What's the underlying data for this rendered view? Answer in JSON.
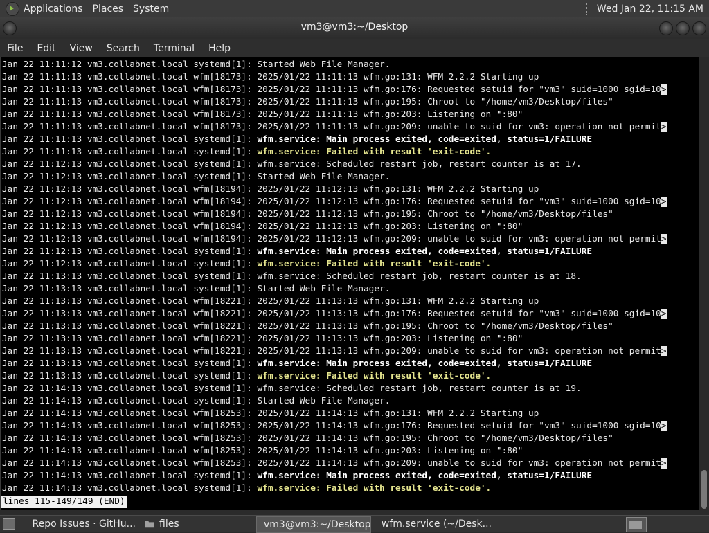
{
  "top_panel": {
    "menus": [
      "Applications",
      "Places",
      "System"
    ],
    "clock": "Wed Jan 22, 11:15 AM"
  },
  "window": {
    "title": "vm3@vm3:~/Desktop"
  },
  "menubar": [
    "File",
    "Edit",
    "View",
    "Search",
    "Terminal",
    "Help"
  ],
  "terminal": {
    "lines": [
      {
        "p": "Jan 22 11:11:12 vm3.collabnet.local systemd[1]: ",
        "m": "Started Web File Manager.",
        "s": "n",
        "t": false
      },
      {
        "p": "Jan 22 11:11:13 vm3.collabnet.local wfm[18173]: ",
        "m": "2025/01/22 11:11:13 wfm.go:131: WFM 2.2.2 Starting up",
        "s": "n",
        "t": false
      },
      {
        "p": "Jan 22 11:11:13 vm3.collabnet.local wfm[18173]: ",
        "m": "2025/01/22 11:11:13 wfm.go:176: Requested setuid for \"vm3\" suid=1000 sgid=10",
        "s": "n",
        "t": true
      },
      {
        "p": "Jan 22 11:11:13 vm3.collabnet.local wfm[18173]: ",
        "m": "2025/01/22 11:11:13 wfm.go:195: Chroot to \"/home/vm3/Desktop/files\"",
        "s": "n",
        "t": false
      },
      {
        "p": "Jan 22 11:11:13 vm3.collabnet.local wfm[18173]: ",
        "m": "2025/01/22 11:11:13 wfm.go:203: Listening on \":80\"",
        "s": "n",
        "t": false
      },
      {
        "p": "Jan 22 11:11:13 vm3.collabnet.local wfm[18173]: ",
        "m": "2025/01/22 11:11:13 wfm.go:209: unable to suid for vm3: operation not permit",
        "s": "n",
        "t": true
      },
      {
        "p": "Jan 22 11:11:13 vm3.collabnet.local systemd[1]: ",
        "m": "wfm.service: Main process exited, code=exited, status=1/FAILURE",
        "s": "b",
        "t": false
      },
      {
        "p": "Jan 22 11:11:13 vm3.collabnet.local systemd[1]: ",
        "m": "wfm.service: Failed with result 'exit-code'.",
        "s": "y",
        "t": false
      },
      {
        "p": "Jan 22 11:12:13 vm3.collabnet.local systemd[1]: ",
        "m": "wfm.service: Scheduled restart job, restart counter is at 17.",
        "s": "n",
        "t": false
      },
      {
        "p": "Jan 22 11:12:13 vm3.collabnet.local systemd[1]: ",
        "m": "Started Web File Manager.",
        "s": "n",
        "t": false
      },
      {
        "p": "Jan 22 11:12:13 vm3.collabnet.local wfm[18194]: ",
        "m": "2025/01/22 11:12:13 wfm.go:131: WFM 2.2.2 Starting up",
        "s": "n",
        "t": false
      },
      {
        "p": "Jan 22 11:12:13 vm3.collabnet.local wfm[18194]: ",
        "m": "2025/01/22 11:12:13 wfm.go:176: Requested setuid for \"vm3\" suid=1000 sgid=10",
        "s": "n",
        "t": true
      },
      {
        "p": "Jan 22 11:12:13 vm3.collabnet.local wfm[18194]: ",
        "m": "2025/01/22 11:12:13 wfm.go:195: Chroot to \"/home/vm3/Desktop/files\"",
        "s": "n",
        "t": false
      },
      {
        "p": "Jan 22 11:12:13 vm3.collabnet.local wfm[18194]: ",
        "m": "2025/01/22 11:12:13 wfm.go:203: Listening on \":80\"",
        "s": "n",
        "t": false
      },
      {
        "p": "Jan 22 11:12:13 vm3.collabnet.local wfm[18194]: ",
        "m": "2025/01/22 11:12:13 wfm.go:209: unable to suid for vm3: operation not permit",
        "s": "n",
        "t": true
      },
      {
        "p": "Jan 22 11:12:13 vm3.collabnet.local systemd[1]: ",
        "m": "wfm.service: Main process exited, code=exited, status=1/FAILURE",
        "s": "b",
        "t": false
      },
      {
        "p": "Jan 22 11:12:13 vm3.collabnet.local systemd[1]: ",
        "m": "wfm.service: Failed with result 'exit-code'.",
        "s": "y",
        "t": false
      },
      {
        "p": "Jan 22 11:13:13 vm3.collabnet.local systemd[1]: ",
        "m": "wfm.service: Scheduled restart job, restart counter is at 18.",
        "s": "n",
        "t": false
      },
      {
        "p": "Jan 22 11:13:13 vm3.collabnet.local systemd[1]: ",
        "m": "Started Web File Manager.",
        "s": "n",
        "t": false
      },
      {
        "p": "Jan 22 11:13:13 vm3.collabnet.local wfm[18221]: ",
        "m": "2025/01/22 11:13:13 wfm.go:131: WFM 2.2.2 Starting up",
        "s": "n",
        "t": false
      },
      {
        "p": "Jan 22 11:13:13 vm3.collabnet.local wfm[18221]: ",
        "m": "2025/01/22 11:13:13 wfm.go:176: Requested setuid for \"vm3\" suid=1000 sgid=10",
        "s": "n",
        "t": true
      },
      {
        "p": "Jan 22 11:13:13 vm3.collabnet.local wfm[18221]: ",
        "m": "2025/01/22 11:13:13 wfm.go:195: Chroot to \"/home/vm3/Desktop/files\"",
        "s": "n",
        "t": false
      },
      {
        "p": "Jan 22 11:13:13 vm3.collabnet.local wfm[18221]: ",
        "m": "2025/01/22 11:13:13 wfm.go:203: Listening on \":80\"",
        "s": "n",
        "t": false
      },
      {
        "p": "Jan 22 11:13:13 vm3.collabnet.local wfm[18221]: ",
        "m": "2025/01/22 11:13:13 wfm.go:209: unable to suid for vm3: operation not permit",
        "s": "n",
        "t": true
      },
      {
        "p": "Jan 22 11:13:13 vm3.collabnet.local systemd[1]: ",
        "m": "wfm.service: Main process exited, code=exited, status=1/FAILURE",
        "s": "b",
        "t": false
      },
      {
        "p": "Jan 22 11:13:13 vm3.collabnet.local systemd[1]: ",
        "m": "wfm.service: Failed with result 'exit-code'.",
        "s": "y",
        "t": false
      },
      {
        "p": "Jan 22 11:14:13 vm3.collabnet.local systemd[1]: ",
        "m": "wfm.service: Scheduled restart job, restart counter is at 19.",
        "s": "n",
        "t": false
      },
      {
        "p": "Jan 22 11:14:13 vm3.collabnet.local systemd[1]: ",
        "m": "Started Web File Manager.",
        "s": "n",
        "t": false
      },
      {
        "p": "Jan 22 11:14:13 vm3.collabnet.local wfm[18253]: ",
        "m": "2025/01/22 11:14:13 wfm.go:131: WFM 2.2.2 Starting up",
        "s": "n",
        "t": false
      },
      {
        "p": "Jan 22 11:14:13 vm3.collabnet.local wfm[18253]: ",
        "m": "2025/01/22 11:14:13 wfm.go:176: Requested setuid for \"vm3\" suid=1000 sgid=10",
        "s": "n",
        "t": true
      },
      {
        "p": "Jan 22 11:14:13 vm3.collabnet.local wfm[18253]: ",
        "m": "2025/01/22 11:14:13 wfm.go:195: Chroot to \"/home/vm3/Desktop/files\"",
        "s": "n",
        "t": false
      },
      {
        "p": "Jan 22 11:14:13 vm3.collabnet.local wfm[18253]: ",
        "m": "2025/01/22 11:14:13 wfm.go:203: Listening on \":80\"",
        "s": "n",
        "t": false
      },
      {
        "p": "Jan 22 11:14:13 vm3.collabnet.local wfm[18253]: ",
        "m": "2025/01/22 11:14:13 wfm.go:209: unable to suid for vm3: operation not permit",
        "s": "n",
        "t": true
      },
      {
        "p": "Jan 22 11:14:13 vm3.collabnet.local systemd[1]: ",
        "m": "wfm.service: Main process exited, code=exited, status=1/FAILURE",
        "s": "b",
        "t": false
      },
      {
        "p": "Jan 22 11:14:13 vm3.collabnet.local systemd[1]: ",
        "m": "wfm.service: Failed with result 'exit-code'.",
        "s": "y",
        "t": false
      }
    ],
    "truncation_marker": ">",
    "pager_status": "lines 115-149/149 (END)"
  },
  "taskbar": {
    "tasks": [
      {
        "label": "Repo Issues · GitHu...",
        "icon": "firefox-icon"
      },
      {
        "label": "files",
        "icon": "folder-icon"
      },
      {
        "label": "vm3@vm3:~/Desktop",
        "icon": "terminal-icon"
      },
      {
        "label": "wfm.service (~/Desk...",
        "icon": "text-editor-icon"
      }
    ]
  },
  "colors": {
    "terminal_bg": "#000000",
    "terminal_fg": "#e8e8e8",
    "highlight_yellow": "#e4e48e",
    "panel_bg": "#3a3a3a"
  }
}
